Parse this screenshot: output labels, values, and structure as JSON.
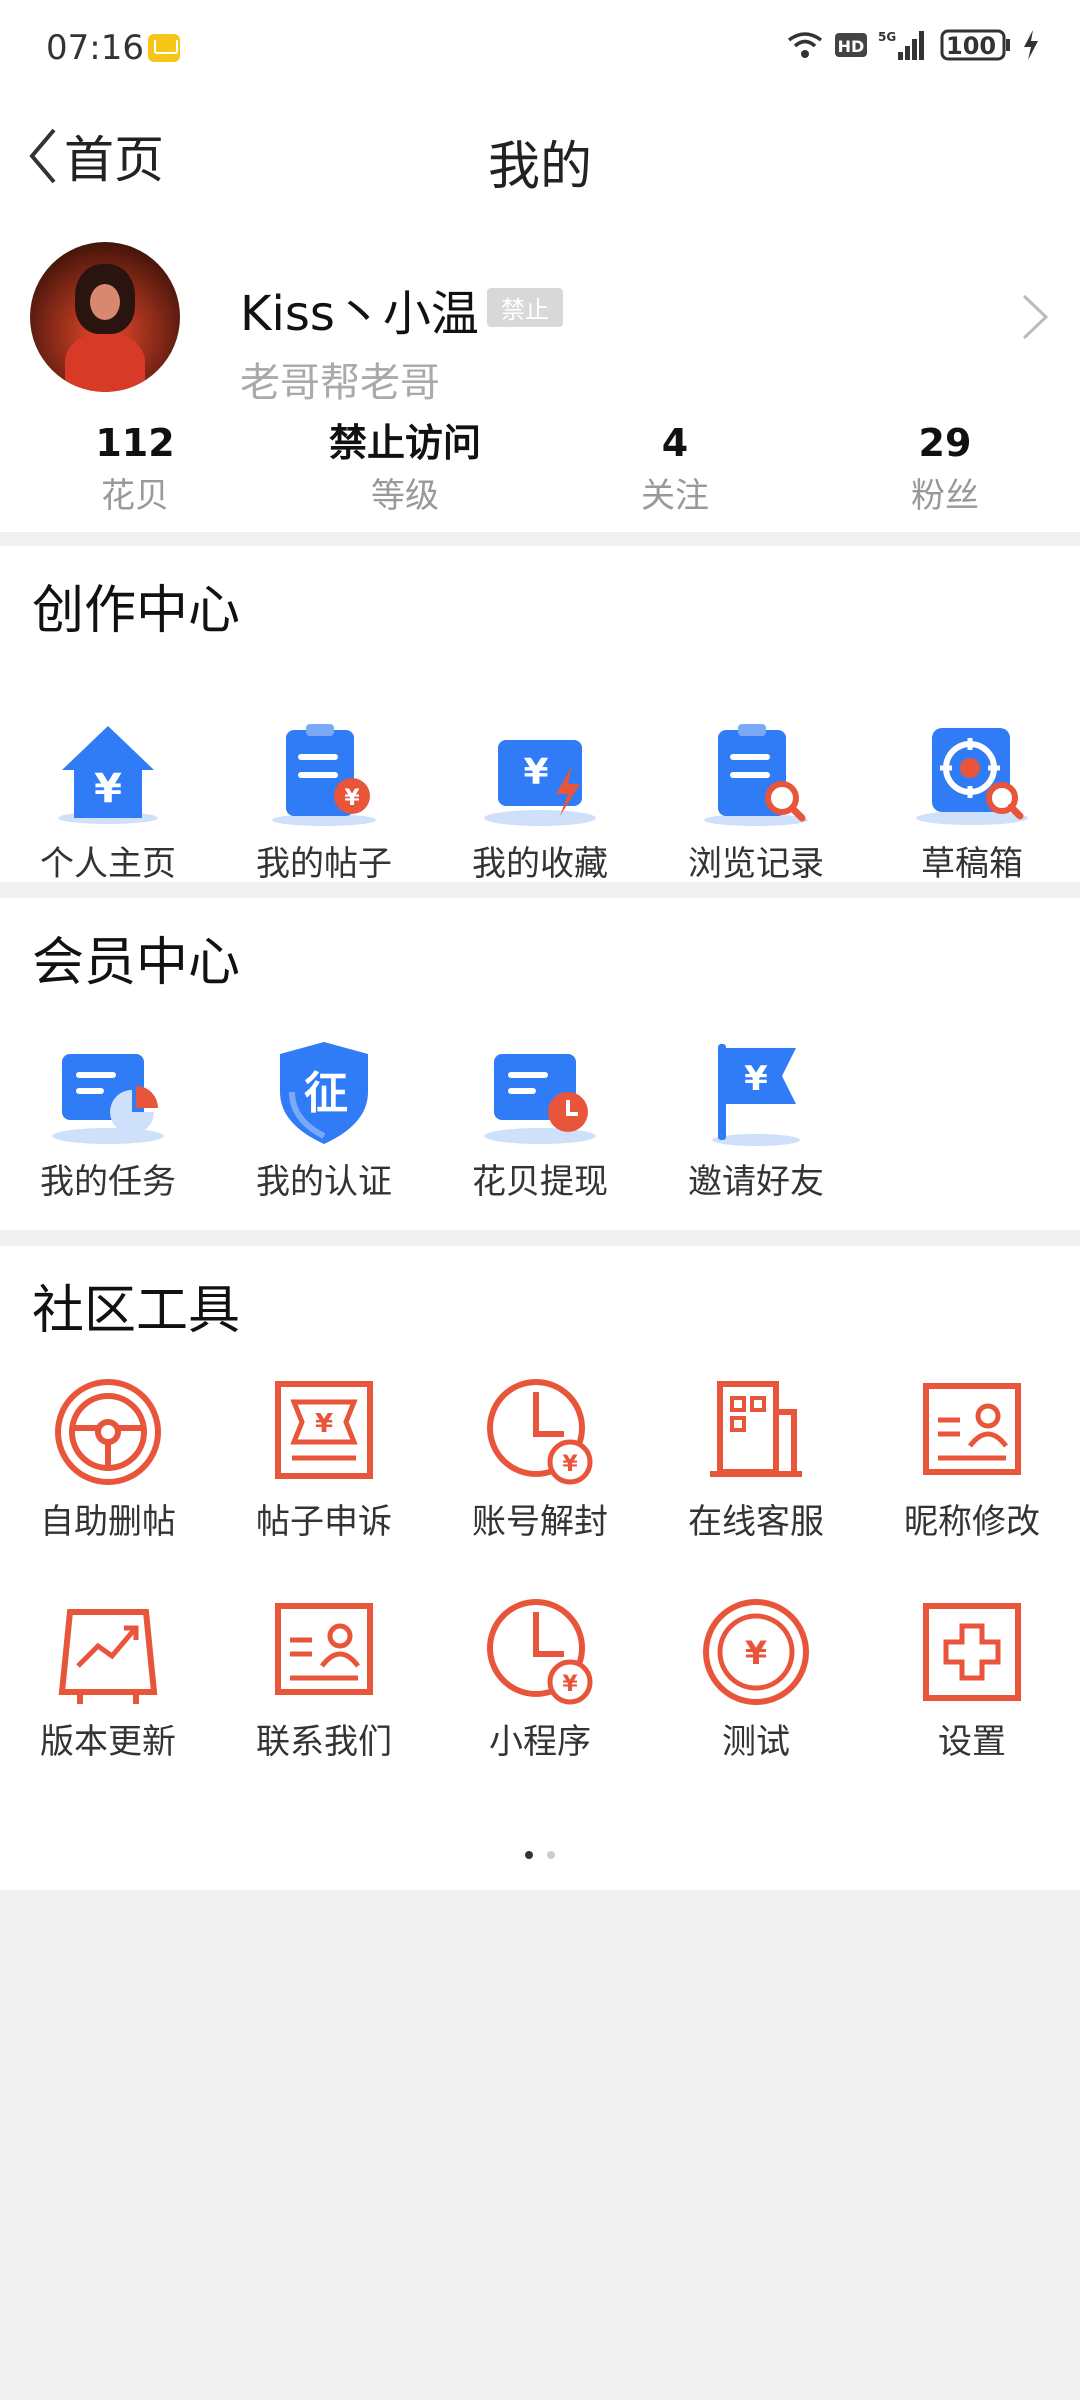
{
  "status_bar": {
    "time": "07:16",
    "battery": "100"
  },
  "nav": {
    "back_label": "首页",
    "title": "我的"
  },
  "profile": {
    "username": "Kiss丶小温",
    "badge": "禁止",
    "subtitle": "老哥帮老哥"
  },
  "stats": [
    {
      "value": "112",
      "label": "花贝"
    },
    {
      "value": "禁止访问",
      "label": "等级"
    },
    {
      "value": "4",
      "label": "关注"
    },
    {
      "value": "29",
      "label": "粉丝"
    }
  ],
  "creation": {
    "title": "创作中心",
    "items": [
      {
        "label": "个人主页",
        "icon": "home-yen-icon"
      },
      {
        "label": "我的帖子",
        "icon": "clipboard-yen-icon"
      },
      {
        "label": "我的收藏",
        "icon": "wallet-lightning-icon"
      },
      {
        "label": "浏览记录",
        "icon": "clipboard-search-icon"
      },
      {
        "label": "草稿箱",
        "icon": "target-search-icon"
      }
    ]
  },
  "member": {
    "title": "会员中心",
    "items": [
      {
        "label": "我的任务",
        "icon": "card-pie-icon"
      },
      {
        "label": "我的认证",
        "icon": "shield-verify-icon"
      },
      {
        "label": "花贝提现",
        "icon": "card-clock-icon"
      },
      {
        "label": "邀请好友",
        "icon": "flag-yen-icon"
      }
    ]
  },
  "tools": {
    "title": "社区工具",
    "items": [
      {
        "label": "自助删帖",
        "icon": "steering-wheel-icon"
      },
      {
        "label": "帖子申诉",
        "icon": "banknote-icon"
      },
      {
        "label": "账号解封",
        "icon": "clock-yen-icon"
      },
      {
        "label": "在线客服",
        "icon": "building-icon"
      },
      {
        "label": "昵称修改",
        "icon": "id-card-icon"
      },
      {
        "label": "版本更新",
        "icon": "chart-up-icon"
      },
      {
        "label": "联系我们",
        "icon": "contact-card-icon"
      },
      {
        "label": "小程序",
        "icon": "clock-yen-icon"
      },
      {
        "label": "测试",
        "icon": "coin-yen-icon"
      },
      {
        "label": "设置",
        "icon": "plus-box-icon"
      }
    ]
  },
  "colors": {
    "blue": "#2f7cf6",
    "orange": "#e8553a",
    "light_blue": "#cfe0fb"
  }
}
